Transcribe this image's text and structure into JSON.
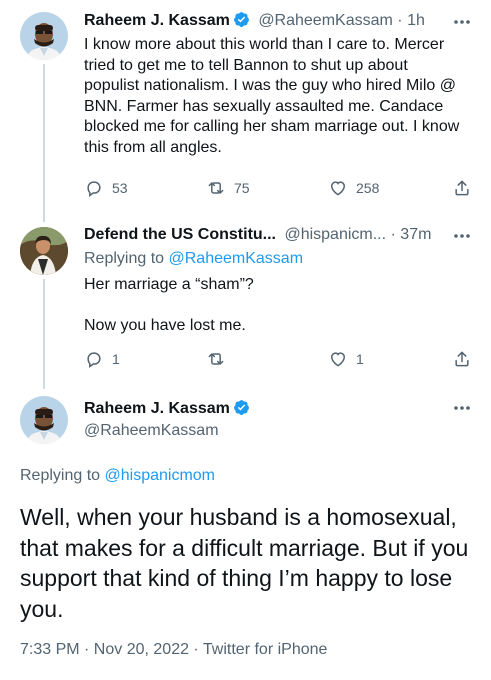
{
  "tweet1": {
    "name": "Raheem J. Kassam",
    "handle": "@RaheemKassam",
    "time": "1h",
    "text": "I know more about this world than I care to. Mercer tried to get me to tell Bannon to shut up about populist nationalism. I was the guy who hired Milo @ BNN. Farmer has sexually assaulted me. Candace blocked me for calling her sham marriage out. I know this from all angles.",
    "replies": "53",
    "retweets": "75",
    "likes": "258"
  },
  "tweet2": {
    "name": "Defend the US Constitu...",
    "handle": "@hispanicm...",
    "time": "37m",
    "replying_prefix": "Replying to ",
    "replying_to": "@RaheemKassam",
    "line1": "Her marriage a “sham”?",
    "line2": "Now you have lost me.",
    "replies": "1",
    "likes": "1"
  },
  "tweet3": {
    "name": "Raheem J. Kassam",
    "handle": "@RaheemKassam",
    "replying_prefix": "Replying to ",
    "replying_to": "@hispanicmom",
    "text": "Well, when your husband is a homosexual, that makes for a difficult marriage. But if you support that kind of thing I’m happy to lose you.",
    "timestamp": "7:33 PM · Nov 20, 2022 · Twitter for iPhone"
  },
  "colors": {
    "accent": "#1d9bf0",
    "muted": "#536471",
    "text": "#0f1419",
    "thread_line": "#cfd9de"
  },
  "icons": [
    "reply-icon",
    "retweet-icon",
    "like-icon",
    "share-icon",
    "more-icon",
    "verified-badge-icon"
  ]
}
